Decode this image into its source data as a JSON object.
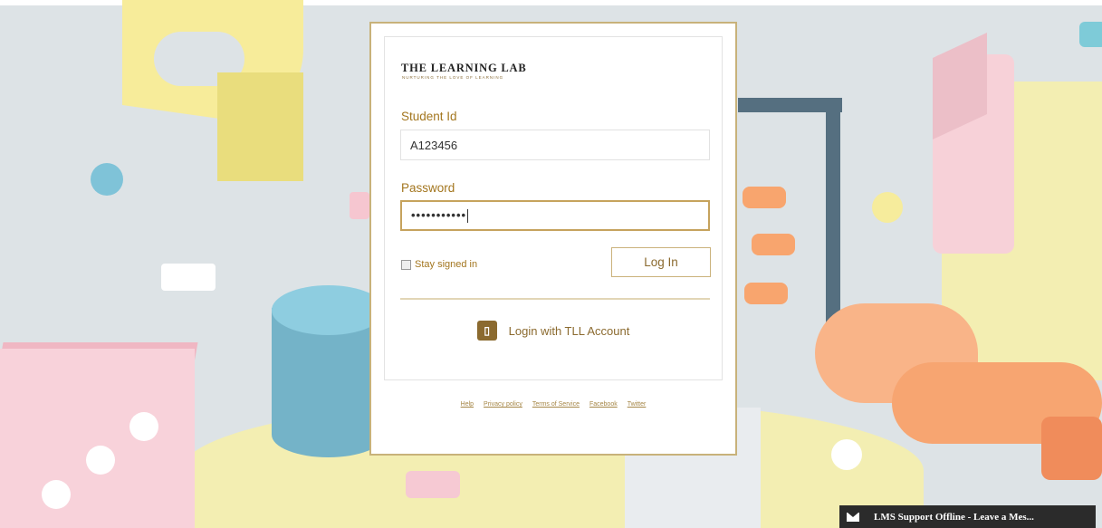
{
  "brand": {
    "title": "THE LEARNING LAB",
    "tagline": "NURTURING THE LOVE OF LEARNING"
  },
  "form": {
    "student_id_label": "Student Id",
    "student_id_value": "A123456",
    "password_label": "Password",
    "password_value": "•••••••••••",
    "stay_signed_in_label": "Stay signed in",
    "stay_signed_in_checked": false,
    "login_button_label": "Log In",
    "tll_login_label": "Login with TLL Account"
  },
  "footer": {
    "links": [
      "Help",
      "Privacy policy",
      "Terms of Service",
      "Facebook",
      "Twitter"
    ]
  },
  "chat": {
    "label": "LMS Support Offline - Leave a Mes..."
  },
  "colors": {
    "accent": "#a3761f",
    "card_border": "#c8b27a",
    "chat_bg": "#2b2b2b"
  },
  "icons": {
    "tll": "office-logo-icon",
    "chat": "envelope-icon"
  }
}
